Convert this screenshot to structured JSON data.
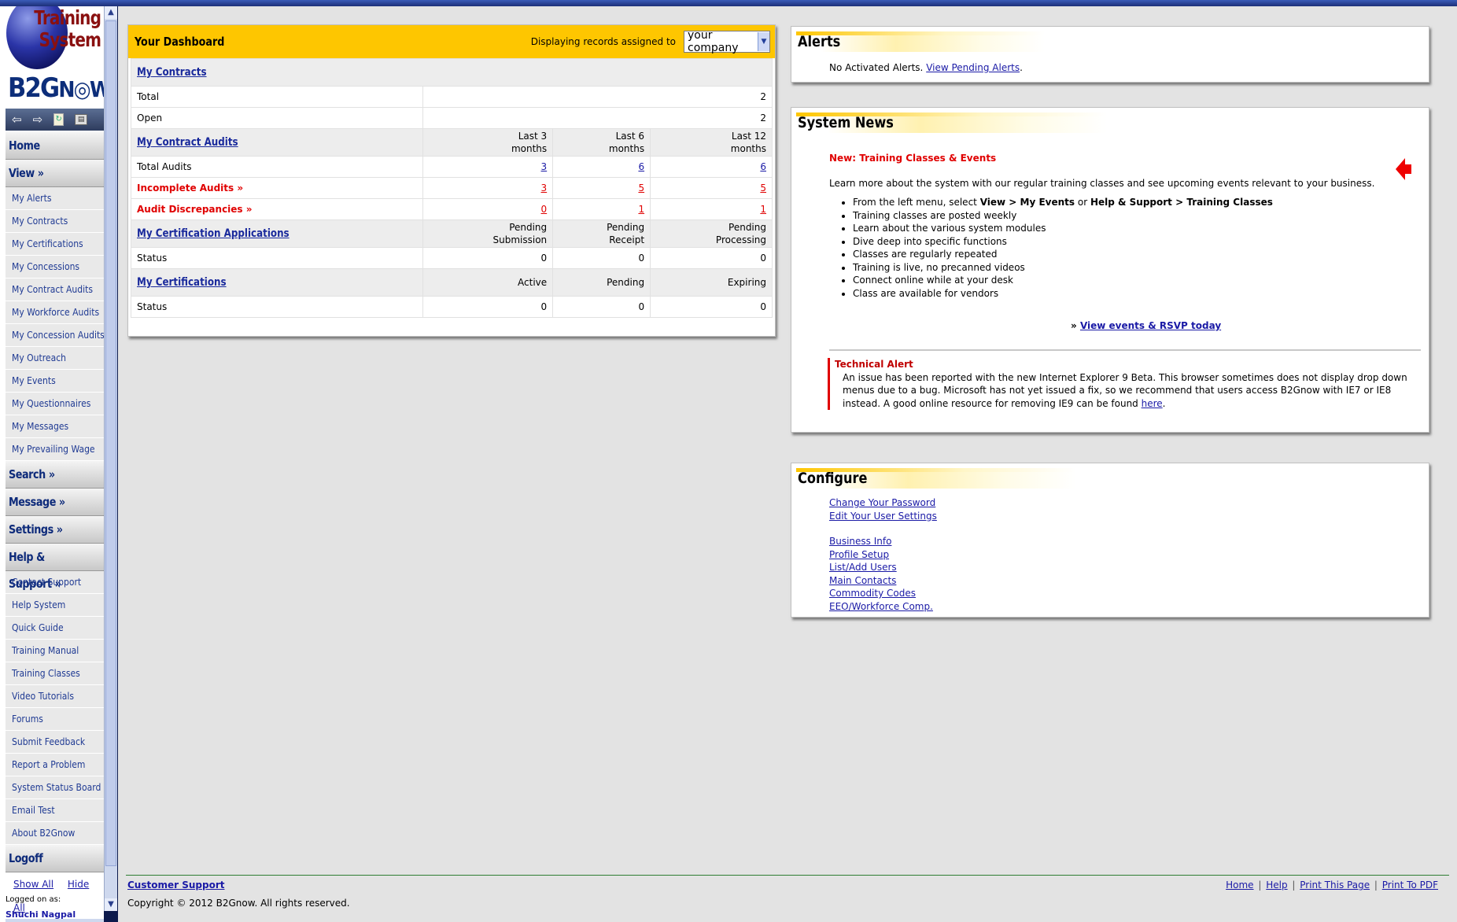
{
  "sidebar": {
    "logo": {
      "line1": "Training",
      "line2": "System",
      "brand_b2g": "B2G",
      "brand_now": "N",
      "brand_now2": "W"
    },
    "nav_icons": [
      "back-arrow-icon",
      "forward-arrow-icon",
      "refresh-icon",
      "print-icon"
    ],
    "menu": {
      "home": "Home",
      "view": "View »",
      "view_items": [
        "My Alerts",
        "My Contracts",
        "My Certifications",
        "My Concessions",
        "My Contract Audits",
        "My Workforce Audits",
        "My Concession Audits",
        "My Outreach",
        "My Events",
        "My Questionnaires",
        "My Messages",
        "My Prevailing Wage"
      ],
      "search": "Search »",
      "message": "Message »",
      "settings": "Settings »",
      "help": "Help & Support »",
      "help_items": [
        "Contact Support",
        "Help System",
        "Quick Guide",
        "Training Manual",
        "Training Classes",
        "Video Tutorials",
        "Forums",
        "Submit Feedback",
        "Report a Problem",
        "System Status Board",
        "Email Test",
        "About B2Gnow"
      ],
      "logoff": "Logoff",
      "show_all": "Show All",
      "hide_all": "Hide All"
    },
    "logged_on_label": "Logged on as:",
    "logged_on_user": "Shuchi Nagpal"
  },
  "dashboard": {
    "title": "Your Dashboard",
    "displaying_label": "Displaying records assigned to",
    "company_select": "your company",
    "contracts": {
      "heading": "My Contracts",
      "rows": [
        {
          "label": "Total",
          "value": "2"
        },
        {
          "label": "Open",
          "value": "2"
        }
      ]
    },
    "audits": {
      "heading": "My Contract Audits",
      "columns": [
        {
          "l1": "Last 3",
          "l2": "months"
        },
        {
          "l1": "Last 6",
          "l2": "months"
        },
        {
          "l1": "Last 12",
          "l2": "months"
        }
      ],
      "rows": [
        {
          "label": "Total Audits",
          "values": [
            "3",
            "6",
            "6"
          ]
        },
        {
          "label": "Incomplete Audits »",
          "values": [
            "3",
            "5",
            "5"
          ]
        },
        {
          "label": "Audit Discrepancies »",
          "values": [
            "0",
            "1",
            "1"
          ]
        }
      ]
    },
    "cert_apps": {
      "heading": "My Certification Applications",
      "columns": [
        {
          "l1": "Pending",
          "l2": "Submission"
        },
        {
          "l1": "Pending",
          "l2": "Receipt"
        },
        {
          "l1": "Pending",
          "l2": "Processing"
        }
      ],
      "rows": [
        {
          "label": "Status",
          "values": [
            "0",
            "0",
            "0"
          ]
        }
      ]
    },
    "certs": {
      "heading": "My Certifications",
      "columns": [
        "Active",
        "Pending",
        "Expiring"
      ],
      "rows": [
        {
          "label": "Status",
          "values": [
            "0",
            "0",
            "0"
          ]
        }
      ]
    }
  },
  "alerts": {
    "title": "Alerts",
    "text": "No Activated Alerts.",
    "link": "View Pending Alerts",
    "suffix": "."
  },
  "news": {
    "title": "System News",
    "subtitle": "New: Training Classes & Events",
    "intro": "Learn more about the system with our regular training classes and see upcoming events relevant to your business.",
    "bullet0_pre": "From the left menu, select ",
    "bullet0_b1": "View > My Events",
    "bullet0_mid": " or ",
    "bullet0_b2": "Help & Support > Training Classes",
    "bullets": [
      "Training classes are posted weekly",
      "Learn about the various system modules",
      "Dive deep into specific functions",
      "Classes are regularly repeated",
      "Training is live, no precanned videos",
      "Connect online while at your desk",
      "Class are available for vendors"
    ],
    "link_prefix": "» ",
    "link": "View events & RSVP today",
    "tech_title": "Technical Alert",
    "tech_body": "An issue has been reported with the new Internet Explorer 9 Beta. This browser sometimes does not display drop down menus due to a bug. Microsoft has not yet issued a fix, so we recommend that users access B2Gnow with IE7 or IE8 instead. A good online resource for removing IE9 can be found ",
    "tech_link": "here",
    "tech_end": "."
  },
  "configure": {
    "title": "Configure",
    "group1": [
      "Change Your Password",
      "Edit Your User Settings"
    ],
    "group2": [
      "Business Info",
      "Profile Setup",
      "List/Add Users",
      "Main Contacts",
      "Commodity Codes",
      "EEO/Workforce Comp."
    ]
  },
  "footer": {
    "support": "Customer Support",
    "copyright": "Copyright © 2012 B2Gnow. All rights reserved.",
    "links": [
      "Home",
      "Help",
      "Print This Page",
      "Print To PDF"
    ],
    "separator": "|"
  },
  "colors": {
    "dashboard_header": "#fec600",
    "alert_red": "#e00000",
    "link_blue": "#1a1aa6",
    "menu_blue": "#0d2a7a"
  }
}
